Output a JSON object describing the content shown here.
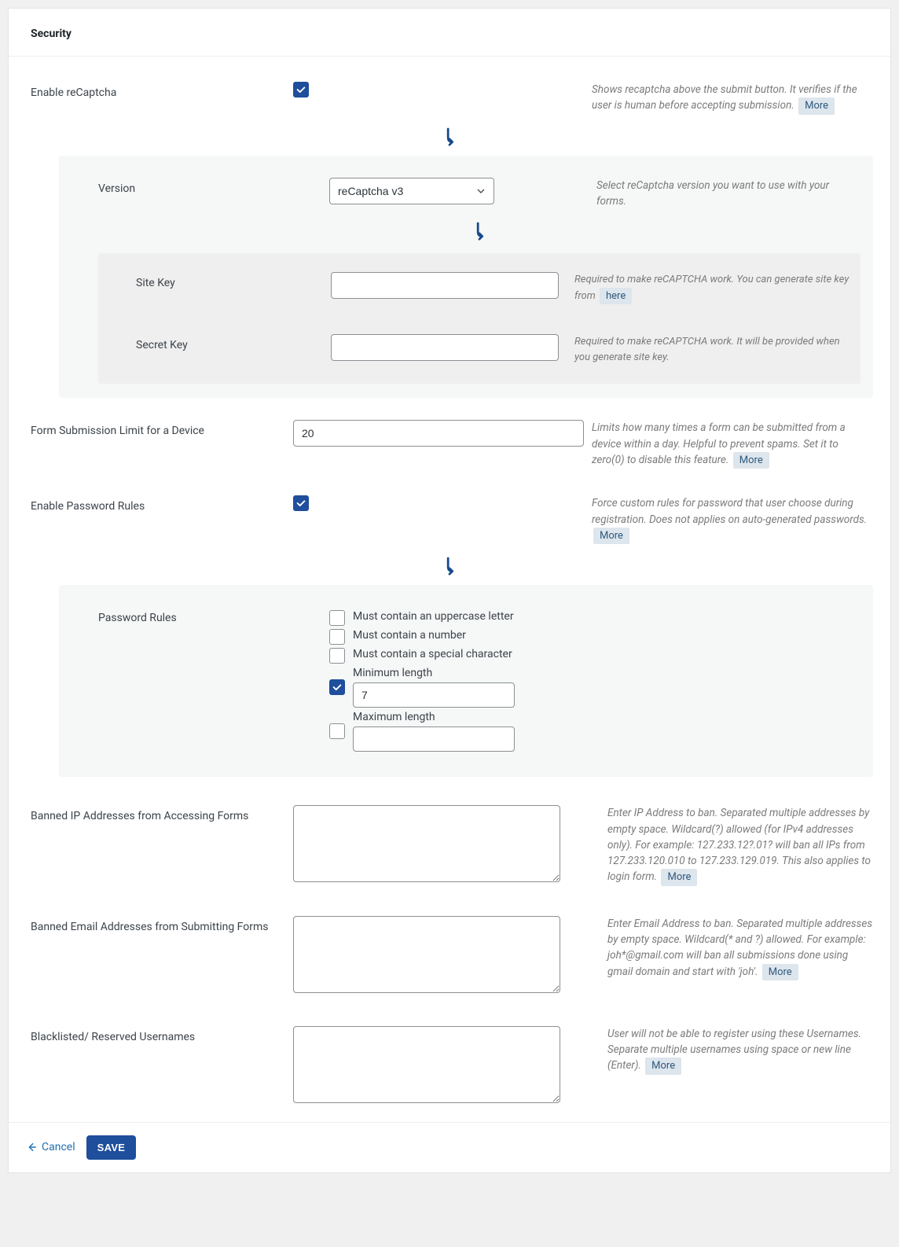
{
  "header": {
    "title": "Security"
  },
  "recaptcha": {
    "enable_label": "Enable reCaptcha",
    "enable_checked": true,
    "enable_help": "Shows recaptcha above the submit button. It verifies if the user is human before accepting submission.",
    "more": "More",
    "version_label": "Version",
    "version_value": "reCaptcha v3",
    "version_help": "Select reCaptcha version you want to use with your forms.",
    "site_key_label": "Site Key",
    "site_key_value": "",
    "site_key_help": "Required to make reCAPTCHA work. You can generate site key from",
    "here": "here",
    "secret_key_label": "Secret Key",
    "secret_key_value": "",
    "secret_key_help": "Required to make reCAPTCHA work. It will be provided when you generate site key."
  },
  "limit": {
    "label": "Form Submission Limit for a Device",
    "value": "20",
    "help": "Limits how many times a form can be submitted from a device within a day. Helpful to prevent spams. Set it to zero(0) to disable this feature.",
    "more": "More"
  },
  "password": {
    "enable_label": "Enable Password Rules",
    "enable_checked": true,
    "enable_help": "Force custom rules for password that user choose during registration. Does not applies on auto-generated passwords.",
    "more": "More",
    "rules_label": "Password Rules",
    "rules": {
      "upper": {
        "label": "Must contain an uppercase letter",
        "checked": false
      },
      "number": {
        "label": "Must contain a number",
        "checked": false
      },
      "special": {
        "label": "Must contain a special character",
        "checked": false
      },
      "min": {
        "label": "Minimum length",
        "checked": true,
        "value": "7"
      },
      "max": {
        "label": "Maximum length",
        "checked": false,
        "value": ""
      }
    }
  },
  "banned_ip": {
    "label": "Banned IP Addresses from Accessing Forms",
    "value": "",
    "help": "Enter IP Address to ban. Separated multiple addresses by empty space. Wildcard(?) allowed (for IPv4 addresses only). For example: 127.233.12?.01? will ban all IPs from 127.233.120.010 to 127.233.129.019. This also applies to login form.",
    "more": "More"
  },
  "banned_email": {
    "label": "Banned Email Addresses from Submitting Forms",
    "value": "",
    "help": "Enter Email Address to ban. Separated multiple addresses by empty space. Wildcard(* and ?) allowed. For example: joh*@gmail.com will ban all submissions done using gmail domain and start with 'joh'.",
    "more": "More"
  },
  "blacklist": {
    "label": "Blacklisted/ Reserved Usernames",
    "value": "",
    "help": "User will not be able to register using these Usernames. Separate multiple usernames using space or new line (Enter).",
    "more": "More"
  },
  "footer": {
    "cancel": "Cancel",
    "save": "SAVE"
  }
}
